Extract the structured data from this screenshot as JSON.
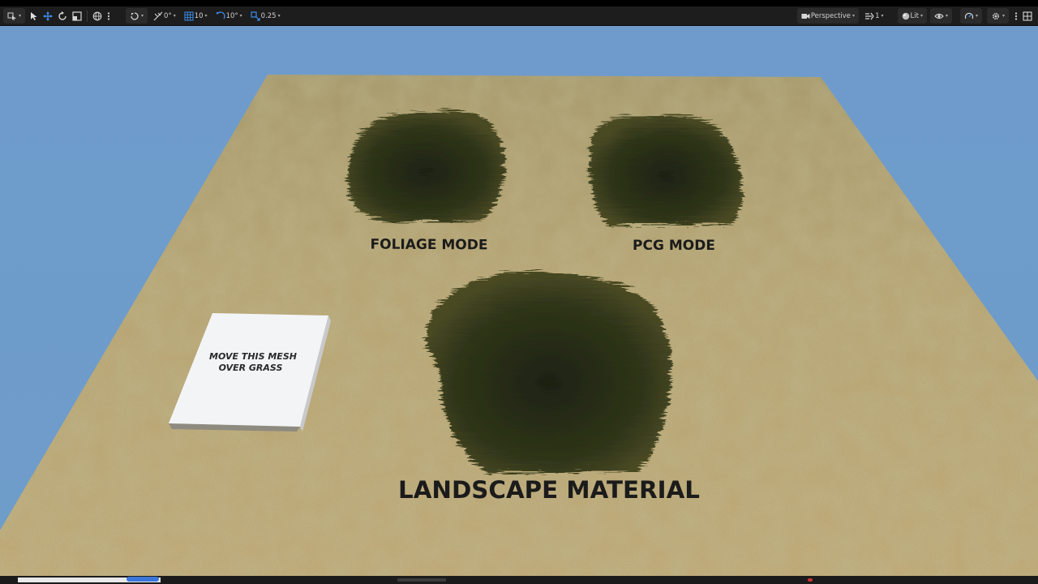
{
  "toolbar": {
    "left": {
      "snap_rotate_value": "0°",
      "grid_snap_value": "10",
      "rotate_snap_value": "10°",
      "scale_snap_value": "0.25"
    },
    "right": {
      "view_mode_label": "Perspective",
      "camera_speed_value": "1",
      "lighting_label": "Lit"
    }
  },
  "scene": {
    "labels": {
      "foliage": "FOLIAGE MODE",
      "pcg": "PCG MODE",
      "landscape": "LANDSCAPE MATERIAL"
    },
    "sign": {
      "line1": "MOVE THIS MESH",
      "line2": "OVER GRASS"
    }
  },
  "colors": {
    "sky": "#6f9dc9",
    "ground": "#b9a470",
    "grass": "#2a3018",
    "toolbar_bg": "#1d1d1d",
    "accent_blue": "#3d8be8"
  }
}
